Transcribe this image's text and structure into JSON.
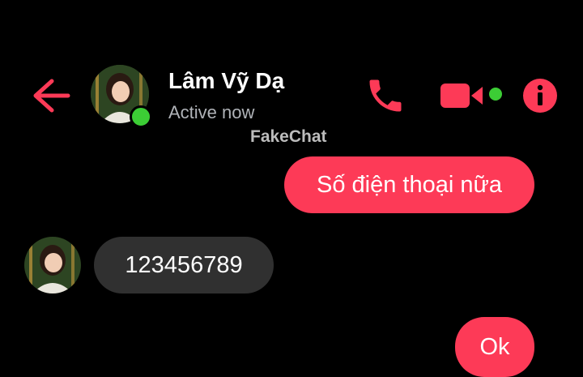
{
  "header": {
    "contact_name": "Lâm Vỹ Dạ",
    "status": "Active now",
    "watermark": "FakeChat",
    "icons": {
      "back": "arrow-left-icon",
      "call": "phone-icon",
      "video": "video-camera-icon",
      "info": "info-icon"
    }
  },
  "messages": [
    {
      "direction": "outgoing",
      "text": "Số điện thoại nữa"
    },
    {
      "direction": "incoming",
      "text": "123456789"
    },
    {
      "direction": "outgoing",
      "text": "Ok"
    }
  ],
  "colors": {
    "accent": "#fd3a57",
    "online": "#3ccd35",
    "incoming_bubble": "#303030",
    "background": "#000000",
    "status_text": "#b0b3b8"
  }
}
